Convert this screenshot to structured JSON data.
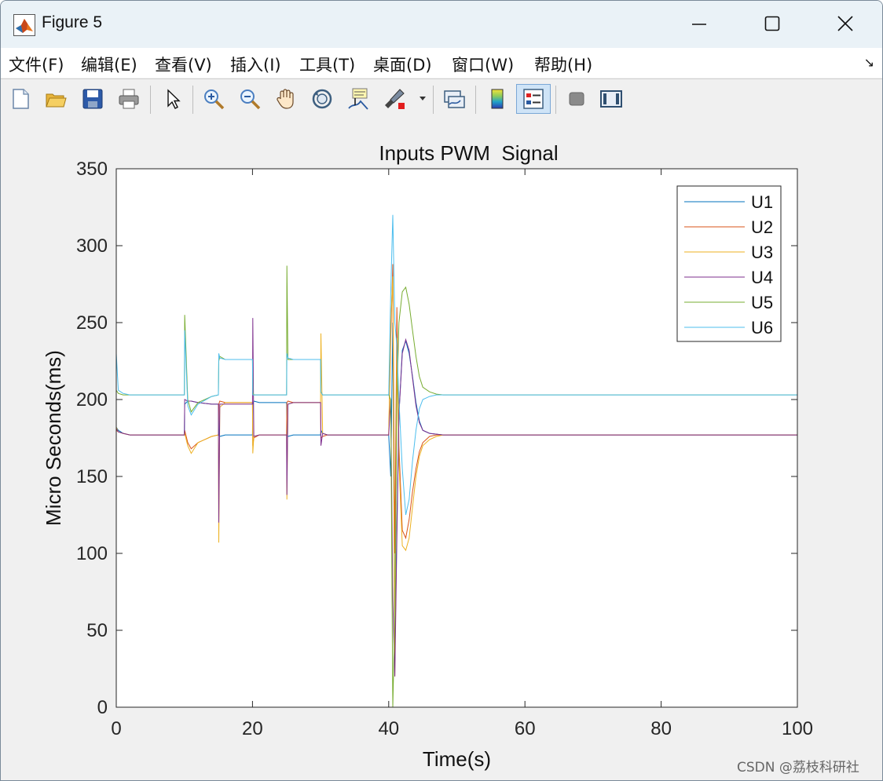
{
  "window": {
    "title": "Figure 5",
    "controls": {
      "minimize": "minimize",
      "maximize": "maximize",
      "close": "close"
    }
  },
  "menu": {
    "items": [
      {
        "label": "文件(F)"
      },
      {
        "label": "编辑(E)"
      },
      {
        "label": "查看(V)"
      },
      {
        "label": "插入(I)"
      },
      {
        "label": "工具(T)"
      },
      {
        "label": "桌面(D)"
      },
      {
        "label": "窗口(W)"
      },
      {
        "label": "帮助(H)"
      }
    ]
  },
  "toolbar": {
    "icons": [
      "new-figure-icon",
      "open-file-icon",
      "save-icon",
      "print-icon",
      "pointer-icon",
      "zoom-in-icon",
      "zoom-out-icon",
      "pan-hand-icon",
      "rotate-3d-icon",
      "data-cursor-icon",
      "brush-icon",
      "brush-dropdown-icon",
      "link-plot-icon",
      "colorbar-icon",
      "legend-icon",
      "hide-plot-tools-icon",
      "show-plot-tools-icon"
    ],
    "active": "legend-icon"
  },
  "watermark": "CSDN @荔枝科研社",
  "colors": {
    "U1": "#0072BD",
    "U2": "#D95319",
    "U3": "#EDB120",
    "U4": "#7E2F8E",
    "U5": "#77AC30",
    "U6": "#4DBEEE"
  },
  "chart_data": {
    "type": "line",
    "title": "Inputs PWM  Signal",
    "xlabel": "Time(s)",
    "ylabel": "Micro Seconds(ms)",
    "xlim": [
      0,
      100
    ],
    "ylim": [
      0,
      350
    ],
    "xticks": [
      0,
      20,
      40,
      60,
      80,
      100
    ],
    "yticks": [
      0,
      50,
      100,
      150,
      200,
      250,
      300,
      350
    ],
    "grid": false,
    "legend_position": "top-right",
    "series": [
      {
        "name": "U1",
        "color": "#0072BD",
        "x": [
          0,
          0.3,
          1,
          2,
          10,
          10.05,
          10.5,
          11,
          12,
          14,
          15,
          15.05,
          15.2,
          16,
          20,
          20.05,
          20.2,
          21,
          25,
          25.05,
          25.2,
          26,
          30,
          30.05,
          30.3,
          31,
          40,
          40.3,
          40.6,
          40.9,
          41.2,
          41.5,
          42,
          42.5,
          43,
          43.5,
          44,
          44.5,
          45,
          46,
          47,
          48,
          50,
          99.9,
          100,
          100
        ],
        "y": [
          182,
          180,
          178,
          177,
          177,
          197,
          199,
          199,
          198,
          197,
          197,
          177,
          176,
          177,
          177,
          197,
          199,
          198,
          198,
          177,
          176,
          177,
          177,
          180,
          178,
          177,
          177,
          150,
          250,
          30,
          120,
          190,
          232,
          238,
          230,
          215,
          198,
          186,
          180,
          178,
          177.5,
          177,
          177,
          177,
          177,
          0
        ]
      },
      {
        "name": "U2",
        "color": "#D95319",
        "x": [
          0,
          0.3,
          1,
          2,
          10,
          10.05,
          10.5,
          11,
          12,
          14,
          15,
          15.05,
          15.2,
          16,
          20,
          20.05,
          20.2,
          21,
          25,
          25.05,
          25.2,
          26,
          30,
          30.05,
          30.3,
          31,
          40,
          40.3,
          40.6,
          40.9,
          41.2,
          41.5,
          42,
          42.5,
          43,
          43.5,
          44,
          44.5,
          45,
          46,
          47,
          48,
          50,
          99.9,
          100,
          100
        ],
        "y": [
          180,
          179,
          178,
          177,
          177,
          180,
          172,
          168,
          172,
          176,
          177,
          197,
          199,
          198,
          198,
          170,
          175,
          177,
          177,
          198,
          199,
          198,
          198,
          175,
          176,
          177,
          177,
          240,
          288,
          100,
          260,
          170,
          115,
          110,
          122,
          140,
          155,
          166,
          172,
          176,
          177,
          177,
          177,
          177,
          177,
          0
        ]
      },
      {
        "name": "U3",
        "color": "#EDB120",
        "x": [
          0,
          0.3,
          1,
          2,
          10,
          10.05,
          10.5,
          11,
          12,
          14,
          15,
          15.05,
          15.2,
          16,
          20,
          20.05,
          20.2,
          21,
          25,
          25.05,
          25.2,
          26,
          30,
          30.05,
          30.3,
          31,
          40,
          40.3,
          40.6,
          40.9,
          41.2,
          41.5,
          42,
          42.5,
          43,
          43.5,
          44,
          44.5,
          45,
          46,
          47,
          48,
          50,
          99.9,
          100,
          100
        ],
        "y": [
          182,
          179,
          178,
          177,
          177,
          178,
          170,
          165,
          172,
          176,
          177,
          107,
          195,
          198,
          198,
          165,
          176,
          177,
          177,
          135,
          197,
          198,
          198,
          243,
          178,
          177,
          177,
          250,
          280,
          20,
          240,
          160,
          105,
          102,
          110,
          130,
          150,
          163,
          170,
          174,
          176,
          177,
          177,
          177,
          177,
          0
        ]
      },
      {
        "name": "U4",
        "color": "#7E2F8E",
        "x": [
          0,
          0.3,
          1,
          2,
          10,
          10.05,
          10.5,
          11,
          12,
          14,
          15,
          15.05,
          15.2,
          16,
          20,
          20.05,
          20.2,
          21,
          25,
          25.05,
          25.2,
          26,
          30,
          30.05,
          30.3,
          31,
          40,
          40.3,
          40.6,
          40.9,
          41.2,
          41.5,
          42,
          42.5,
          43,
          43.5,
          44,
          44.5,
          45,
          46,
          47,
          48,
          50,
          99.9,
          100,
          100
        ],
        "y": [
          181,
          179,
          178,
          177,
          177,
          200,
          199,
          199,
          198,
          197,
          197,
          120,
          197,
          197,
          197,
          253,
          176,
          177,
          177,
          138,
          197,
          198,
          198,
          170,
          178,
          177,
          177,
          200,
          70,
          20,
          110,
          190,
          230,
          239,
          232,
          214,
          196,
          185,
          180,
          178,
          177.5,
          177,
          177,
          177,
          177,
          0
        ]
      },
      {
        "name": "U5",
        "color": "#77AC30",
        "x": [
          0,
          0.3,
          1,
          2,
          10,
          10.05,
          10.5,
          11,
          12,
          14,
          15,
          15.05,
          15.2,
          16,
          20,
          20.05,
          20.2,
          21,
          25,
          25.05,
          25.2,
          26,
          30,
          30.05,
          30.3,
          31,
          40,
          40.3,
          40.6,
          40.9,
          41.2,
          41.5,
          42,
          42.5,
          43,
          43.5,
          44,
          44.5,
          45,
          46,
          47,
          48,
          50,
          99.9,
          100,
          100
        ],
        "y": [
          206,
          204,
          203,
          203,
          203,
          255,
          200,
          192,
          198,
          202,
          203,
          225,
          228,
          226,
          226,
          205,
          203,
          203,
          203,
          287,
          226,
          226,
          226,
          205,
          203,
          203,
          203,
          200,
          0,
          60,
          200,
          250,
          270,
          273,
          262,
          245,
          228,
          215,
          208,
          205,
          203.5,
          203,
          203,
          203,
          203,
          0
        ]
      },
      {
        "name": "U6",
        "color": "#4DBEEE",
        "x": [
          0,
          0.3,
          1,
          2,
          10,
          10.05,
          10.5,
          11,
          12,
          14,
          15,
          15.05,
          15.2,
          16,
          20,
          20.05,
          20.2,
          21,
          25,
          25.05,
          25.2,
          26,
          30,
          30.05,
          30.3,
          31,
          40,
          40.3,
          40.6,
          40.9,
          41.2,
          41.5,
          42,
          42.5,
          43,
          43.5,
          44,
          44.5,
          45,
          46,
          47,
          48,
          50,
          99.9,
          100,
          100
        ],
        "y": [
          230,
          206,
          204,
          203,
          203,
          245,
          196,
          190,
          197,
          202,
          203,
          230,
          227,
          226,
          226,
          203,
          203,
          203,
          203,
          230,
          227,
          226,
          226,
          205,
          203,
          203,
          203,
          270,
          320,
          250,
          235,
          200,
          155,
          125,
          135,
          160,
          180,
          194,
          200,
          202,
          203,
          203,
          203,
          203,
          203,
          0
        ]
      }
    ]
  }
}
